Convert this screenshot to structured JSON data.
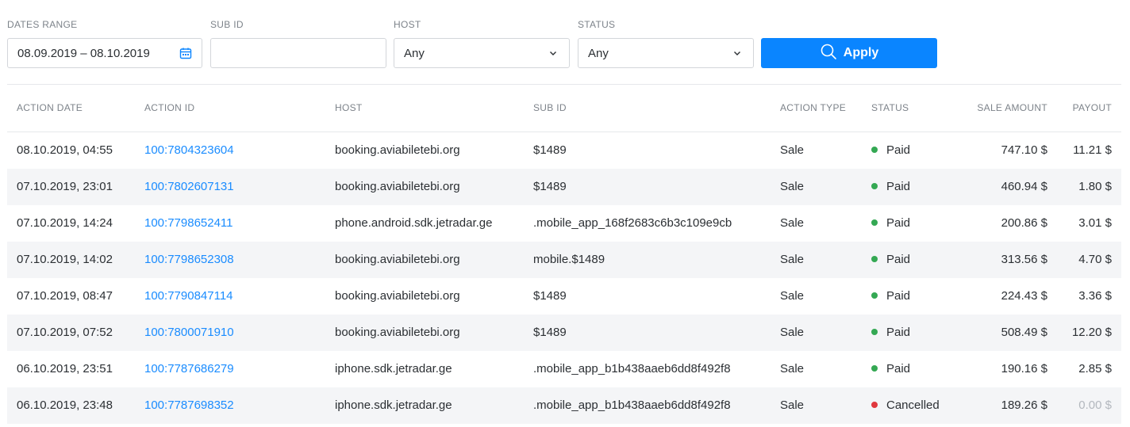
{
  "filters": {
    "dates_range": {
      "label": "DATES RANGE",
      "value": "08.09.2019 – 08.10.2019",
      "icon": "calendar-icon"
    },
    "sub_id": {
      "label": "SUB ID",
      "value": "",
      "placeholder": ""
    },
    "host": {
      "label": "HOST",
      "value": "Any",
      "icon": "chevron-down-icon"
    },
    "status": {
      "label": "STATUS",
      "value": "Any",
      "icon": "chevron-down-icon"
    },
    "apply": {
      "label": "Apply",
      "icon": "search-icon"
    }
  },
  "colors": {
    "accent": "#0a85ff",
    "link": "#1a8cff",
    "paid": "#34a853",
    "cancelled": "#e0383e",
    "row_alt": "#f4f5f7"
  },
  "table": {
    "columns": [
      "ACTION DATE",
      "ACTION ID",
      "HOST",
      "SUB ID",
      "ACTION TYPE",
      "STATUS",
      "SALE AMOUNT",
      "PAYOUT"
    ],
    "rows": [
      {
        "date": "08.10.2019, 04:55",
        "id": "100:7804323604",
        "host": "booking.aviabiletebi.org",
        "sub_id": "$1489",
        "type": "Sale",
        "status": "Paid",
        "amount": "747.10 $",
        "payout": "11.21 $"
      },
      {
        "date": "07.10.2019, 23:01",
        "id": "100:7802607131",
        "host": "booking.aviabiletebi.org",
        "sub_id": "$1489",
        "type": "Sale",
        "status": "Paid",
        "amount": "460.94 $",
        "payout": "1.80 $"
      },
      {
        "date": "07.10.2019, 14:24",
        "id": "100:7798652411",
        "host": "phone.android.sdk.jetradar.ge",
        "sub_id": ".mobile_app_168f2683c6b3c109e9cb",
        "type": "Sale",
        "status": "Paid",
        "amount": "200.86 $",
        "payout": "3.01 $"
      },
      {
        "date": "07.10.2019, 14:02",
        "id": "100:7798652308",
        "host": "booking.aviabiletebi.org",
        "sub_id": "mobile.$1489",
        "type": "Sale",
        "status": "Paid",
        "amount": "313.56 $",
        "payout": "4.70 $"
      },
      {
        "date": "07.10.2019, 08:47",
        "id": "100:7790847114",
        "host": "booking.aviabiletebi.org",
        "sub_id": "$1489",
        "type": "Sale",
        "status": "Paid",
        "amount": "224.43 $",
        "payout": "3.36 $"
      },
      {
        "date": "07.10.2019, 07:52",
        "id": "100:7800071910",
        "host": "booking.aviabiletebi.org",
        "sub_id": "$1489",
        "type": "Sale",
        "status": "Paid",
        "amount": "508.49 $",
        "payout": "12.20 $"
      },
      {
        "date": "06.10.2019, 23:51",
        "id": "100:7787686279",
        "host": "iphone.sdk.jetradar.ge",
        "sub_id": ".mobile_app_b1b438aaeb6dd8f492f8",
        "type": "Sale",
        "status": "Paid",
        "amount": "190.16 $",
        "payout": "2.85 $"
      },
      {
        "date": "06.10.2019, 23:48",
        "id": "100:7787698352",
        "host": "iphone.sdk.jetradar.ge",
        "sub_id": ".mobile_app_b1b438aaeb6dd8f492f8",
        "type": "Sale",
        "status": "Cancelled",
        "amount": "189.26 $",
        "payout": "0.00 $"
      }
    ]
  }
}
